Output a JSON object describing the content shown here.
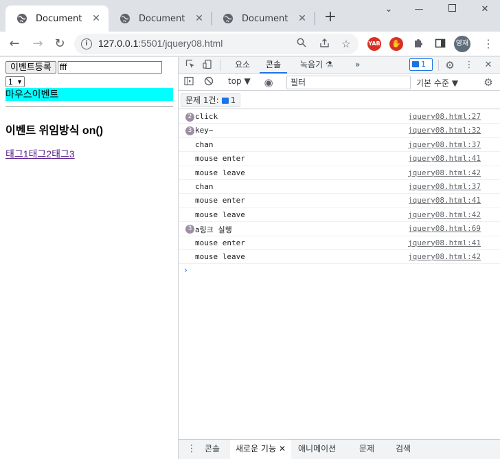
{
  "window": {
    "tabs": [
      {
        "title": "Document",
        "active": true
      },
      {
        "title": "Document",
        "active": false
      },
      {
        "title": "Document",
        "active": false
      }
    ]
  },
  "address": {
    "host": "127.0.0.1",
    "rest": ":5501/jquery08.html"
  },
  "extensions": {
    "yab_label": "YAB",
    "profile_label": "영재"
  },
  "page": {
    "register_button": "이벤트등록",
    "text_input_value": "fff",
    "select_value": "1",
    "mouse_div_text": "마우스이벤트",
    "heading": "이벤트 위임방식 on()",
    "links": [
      "태그1",
      "태그2",
      "태그3"
    ]
  },
  "devtools": {
    "tabs": [
      "요소",
      "콘솔",
      "녹음기"
    ],
    "active_tab": "콘솔",
    "issues_count": "1",
    "context": "top",
    "filter_placeholder": "필터",
    "level": "기본 수준",
    "issues_button": "문제 1건:",
    "issues_button_count": "1",
    "messages": [
      {
        "count": "2",
        "text": "click",
        "src": "jquery08.html:27"
      },
      {
        "count": "3",
        "text": "key~",
        "src": "jquery08.html:32"
      },
      {
        "count": "",
        "text": "chan",
        "src": "jquery08.html:37"
      },
      {
        "count": "",
        "text": "mouse enter",
        "src": "jquery08.html:41"
      },
      {
        "count": "",
        "text": "mouse leave",
        "src": "jquery08.html:42"
      },
      {
        "count": "",
        "text": "chan",
        "src": "jquery08.html:37"
      },
      {
        "count": "",
        "text": "mouse enter",
        "src": "jquery08.html:41"
      },
      {
        "count": "",
        "text": "mouse leave",
        "src": "jquery08.html:42"
      },
      {
        "count": "3",
        "text": "a링크 실행",
        "src": "jquery08.html:69"
      },
      {
        "count": "",
        "text": "mouse enter",
        "src": "jquery08.html:41"
      },
      {
        "count": "",
        "text": "mouse leave",
        "src": "jquery08.html:42"
      }
    ],
    "drawer_tabs": [
      "콘솔",
      "새로운 기능",
      "애니메이션",
      "문제",
      "검색"
    ],
    "drawer_active": "새로운 기능"
  },
  "colors": {
    "mouse_div_bg": "#00ffff",
    "accent": "#1a73e8",
    "visited_link": "#551a8b"
  }
}
